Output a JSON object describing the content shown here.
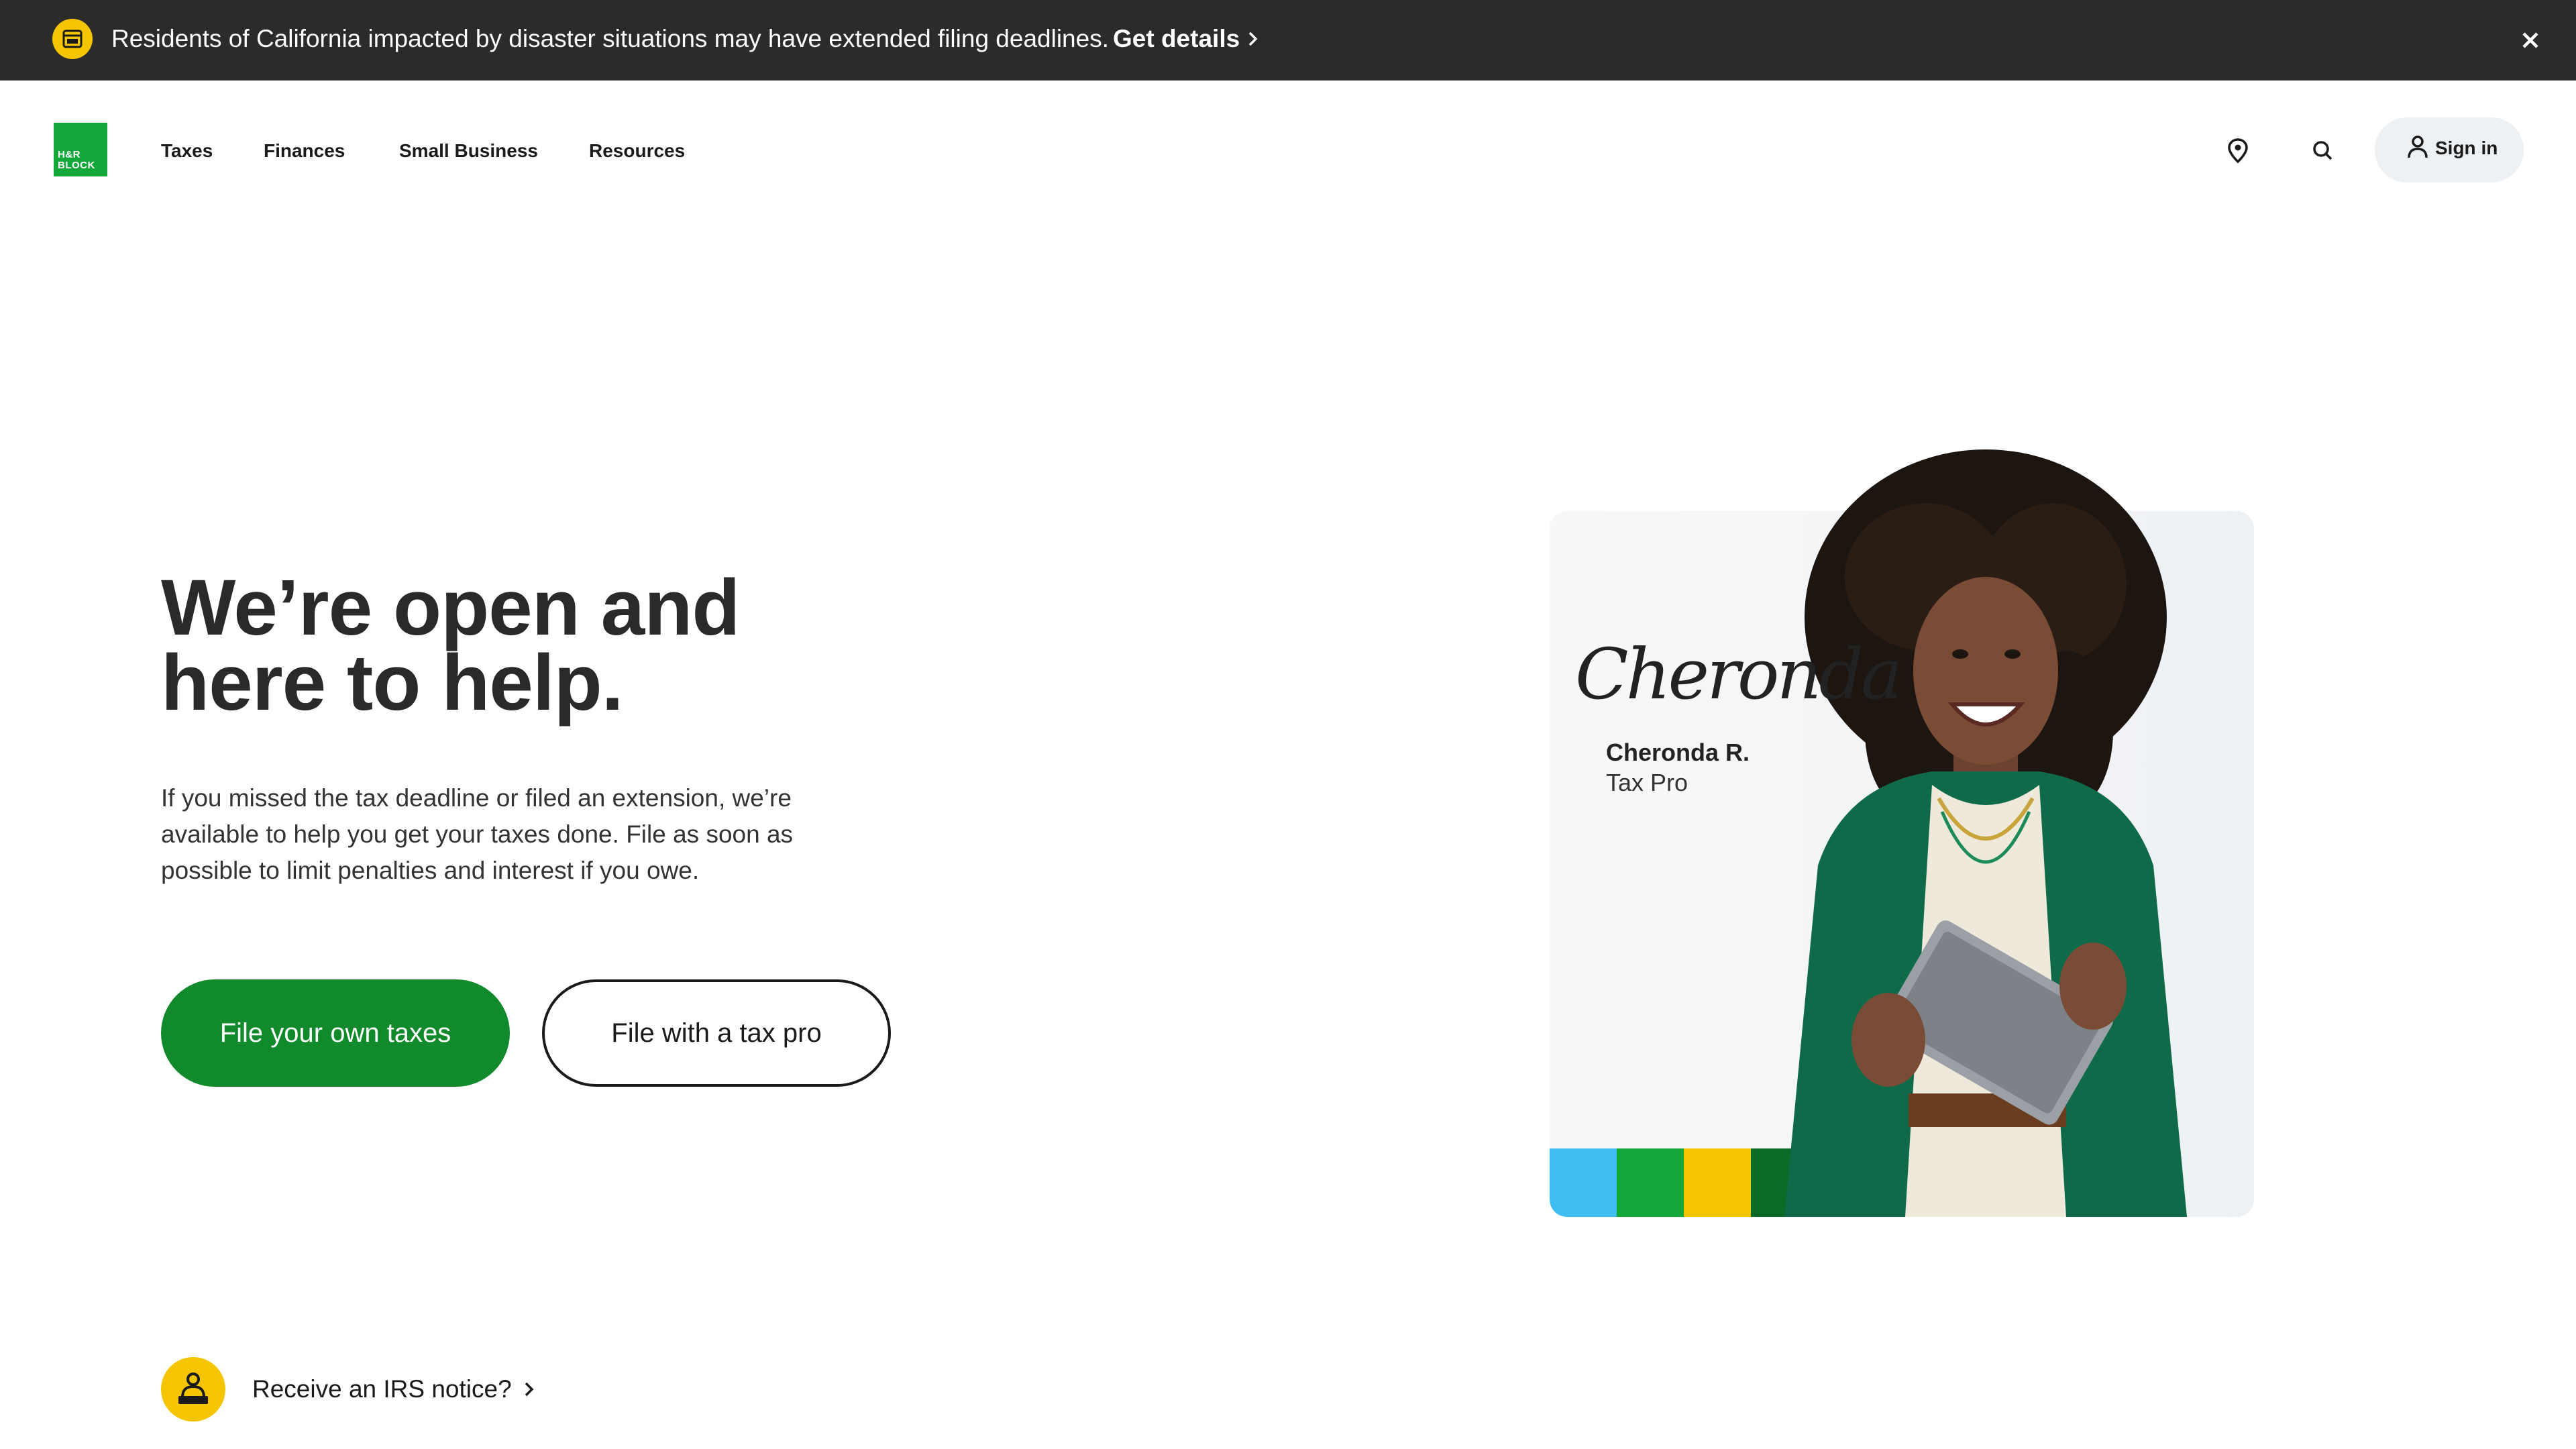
{
  "alert": {
    "icon": "calendar-icon",
    "message": "Residents of California impacted by disaster situations may have extended filing deadlines.",
    "link_label": "Get details",
    "close_icon": "close-icon"
  },
  "header": {
    "logo_text": "H&R BLOCK",
    "nav": [
      "Taxes",
      "Finances",
      "Small Business",
      "Resources"
    ],
    "location_icon": "location-pin-icon",
    "search_icon": "search-icon",
    "signin_label": "Sign in"
  },
  "hero": {
    "title": "We’re open and here to help.",
    "body": "If you missed the tax deadline or filed an extension, we’re available to help you get your taxes done. File as soon as possible to limit penalties and interest if you owe.",
    "primary_button": "File your own taxes",
    "secondary_button": "File with a tax pro"
  },
  "tax_pro": {
    "signature": "Cheronda",
    "name": "Cheronda R.",
    "role": "Tax Pro"
  },
  "irs_notice": {
    "icon": "person-at-desk-icon",
    "label": "Receive an IRS notice?"
  },
  "colors": {
    "brand_green": "#14a83b",
    "button_green": "#118a2c",
    "alert_bg": "#2b2b2b",
    "accent_yellow": "#f4c500",
    "bar_colors": [
      "#3dbdf2",
      "#14a83b",
      "#f4c500",
      "#0a6b26"
    ]
  }
}
